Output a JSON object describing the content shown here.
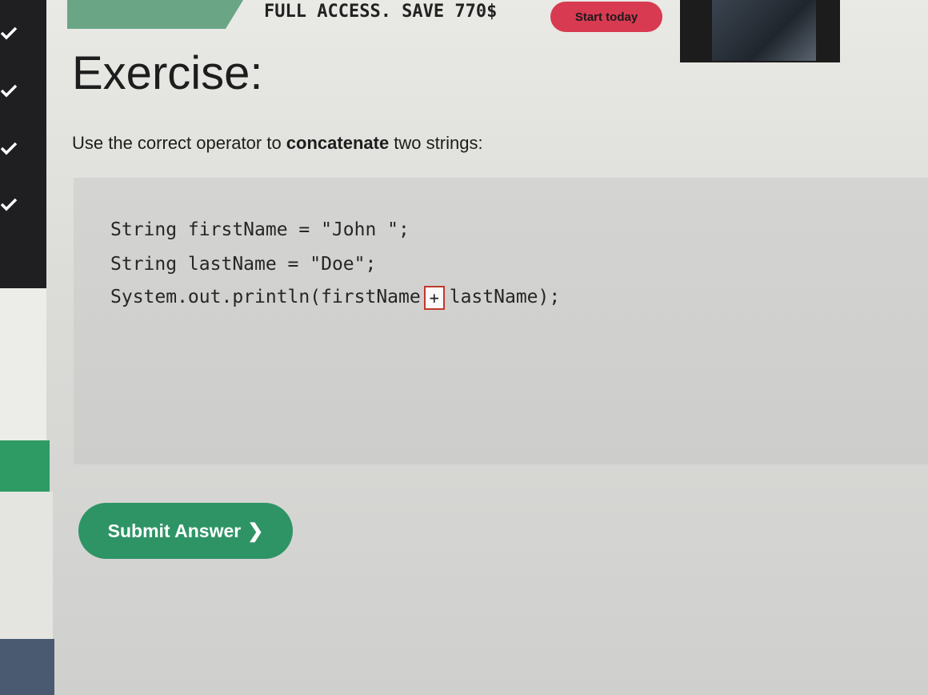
{
  "sidebar": {
    "checks": [
      "check",
      "check",
      "check",
      "check"
    ]
  },
  "banner": {
    "promo_text": "FULL ACCESS. SAVE 770$",
    "start_label": "Start today"
  },
  "exercise": {
    "title": "Exercise:",
    "instruction_prefix": "Use the correct operator to ",
    "instruction_bold": "concatenate",
    "instruction_suffix": " two strings:",
    "code": {
      "line1": "String firstName = \"John \";",
      "line2": "String lastName = \"Doe\";",
      "line3_before": "System.out.println(firstName",
      "line3_after": "lastName);"
    },
    "answer_value": "+",
    "submit_label": "Submit Answer",
    "submit_icon": "chevron-right-icon"
  },
  "colors": {
    "accent_green": "#2e9466",
    "start_red": "#d83a52",
    "input_border": "#c0392b"
  }
}
